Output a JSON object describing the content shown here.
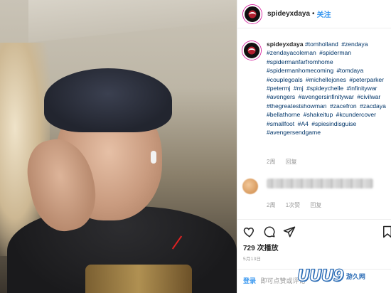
{
  "post": {
    "username": "spideyxdaya",
    "separator": "•",
    "follow_label": "关注"
  },
  "caption": {
    "username": "spideyxdaya",
    "hashtags": [
      "#tomholland",
      "#zendaya",
      "#zendayacoleman",
      "#spiderman",
      "#spidermanfarfromhome",
      "#spidermanhomecoming",
      "#tomdaya",
      "#couplegoals",
      "#michellejones",
      "#peterparker",
      "#petermj",
      "#mj",
      "#spideychelle",
      "#infinitywar",
      "#avengers",
      "#avengersinfinitywar",
      "#civilwar",
      "#thegreatestshowman",
      "#zacefron",
      "#zacdaya",
      "#bellathorne",
      "#shakeitup",
      "#kcundercover",
      "#smallfoot",
      "#A4",
      "#spiesindisguise",
      "#avengersendgame"
    ],
    "meta": {
      "time": "2周",
      "reply": "回复"
    }
  },
  "comment": {
    "meta": {
      "time": "2周",
      "likes": "1次赞",
      "reply": "回复"
    }
  },
  "actions": {
    "icons": [
      "heart-icon",
      "comment-icon",
      "share-icon",
      "bookmark-icon"
    ]
  },
  "views_label": "729 次播放",
  "date_label": "5月13日",
  "login": {
    "link": "登录",
    "prompt": "即可点赞或评论"
  },
  "watermark": {
    "logo": "UUU9",
    "site": "游久网"
  },
  "colors": {
    "link": "#003569",
    "follow": "#3897f0",
    "muted": "#999999"
  }
}
